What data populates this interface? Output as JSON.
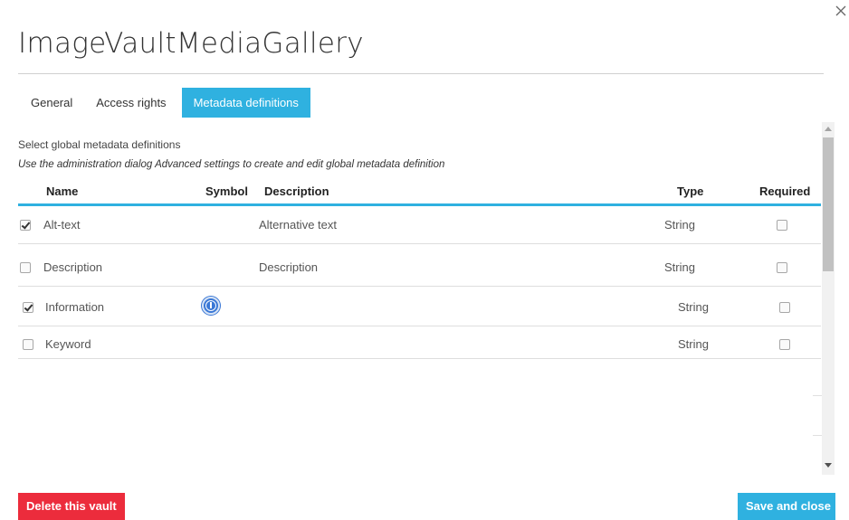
{
  "dialog": {
    "title": "ImageVaultMediaGallery",
    "close_icon": "close-icon"
  },
  "tabs": [
    {
      "label": "General",
      "active": false
    },
    {
      "label": "Access rights",
      "active": false
    },
    {
      "label": "Metadata definitions",
      "active": true
    }
  ],
  "metadata": {
    "hint": "Select global metadata definitions",
    "hint_italic": "Use the administration dialog Advanced settings to create and edit global metadata definition",
    "columns": {
      "name": "Name",
      "symbol": "Symbol",
      "description": "Description",
      "type": "Type",
      "required": "Required"
    },
    "rows": [
      {
        "selected": true,
        "name": "Alt-text",
        "symbol": "",
        "description": "Alternative text",
        "type": "String",
        "required": false
      },
      {
        "selected": false,
        "name": "Description",
        "symbol": "",
        "description": "Description",
        "type": "String",
        "required": false
      },
      {
        "selected": true,
        "name": "Information",
        "symbol": "info-icon",
        "description": "",
        "type": "String",
        "required": false
      },
      {
        "selected": false,
        "name": "Keyword",
        "symbol": "",
        "description": "",
        "type": "String",
        "required": false
      }
    ]
  },
  "footer": {
    "delete_label": "Delete this vault",
    "save_label": "Save and close"
  },
  "colors": {
    "accent": "#2fb1e0",
    "danger": "#ec2c3c",
    "info_icon": "#3a78d6"
  }
}
